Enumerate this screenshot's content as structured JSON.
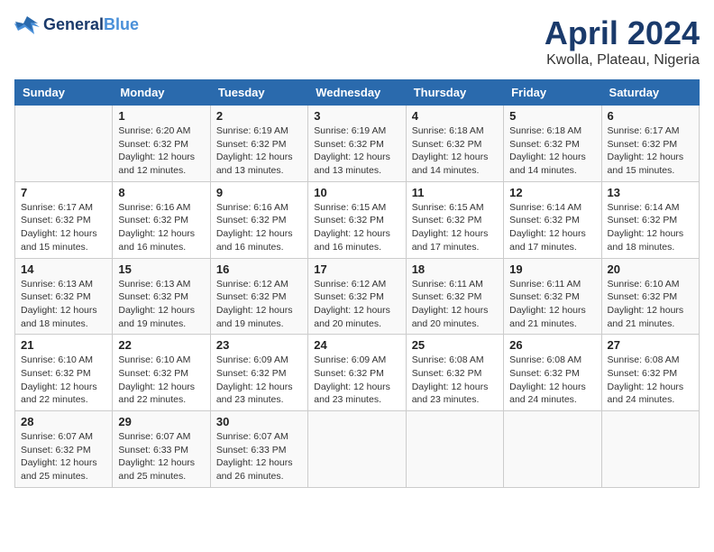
{
  "header": {
    "logo_line1": "General",
    "logo_line2": "Blue",
    "month": "April 2024",
    "location": "Kwolla, Plateau, Nigeria"
  },
  "days_of_week": [
    "Sunday",
    "Monday",
    "Tuesday",
    "Wednesday",
    "Thursday",
    "Friday",
    "Saturday"
  ],
  "weeks": [
    [
      {
        "day": "",
        "info": ""
      },
      {
        "day": "1",
        "info": "Sunrise: 6:20 AM\nSunset: 6:32 PM\nDaylight: 12 hours\nand 12 minutes."
      },
      {
        "day": "2",
        "info": "Sunrise: 6:19 AM\nSunset: 6:32 PM\nDaylight: 12 hours\nand 13 minutes."
      },
      {
        "day": "3",
        "info": "Sunrise: 6:19 AM\nSunset: 6:32 PM\nDaylight: 12 hours\nand 13 minutes."
      },
      {
        "day": "4",
        "info": "Sunrise: 6:18 AM\nSunset: 6:32 PM\nDaylight: 12 hours\nand 14 minutes."
      },
      {
        "day": "5",
        "info": "Sunrise: 6:18 AM\nSunset: 6:32 PM\nDaylight: 12 hours\nand 14 minutes."
      },
      {
        "day": "6",
        "info": "Sunrise: 6:17 AM\nSunset: 6:32 PM\nDaylight: 12 hours\nand 15 minutes."
      }
    ],
    [
      {
        "day": "7",
        "info": "Sunrise: 6:17 AM\nSunset: 6:32 PM\nDaylight: 12 hours\nand 15 minutes."
      },
      {
        "day": "8",
        "info": "Sunrise: 6:16 AM\nSunset: 6:32 PM\nDaylight: 12 hours\nand 16 minutes."
      },
      {
        "day": "9",
        "info": "Sunrise: 6:16 AM\nSunset: 6:32 PM\nDaylight: 12 hours\nand 16 minutes."
      },
      {
        "day": "10",
        "info": "Sunrise: 6:15 AM\nSunset: 6:32 PM\nDaylight: 12 hours\nand 16 minutes."
      },
      {
        "day": "11",
        "info": "Sunrise: 6:15 AM\nSunset: 6:32 PM\nDaylight: 12 hours\nand 17 minutes."
      },
      {
        "day": "12",
        "info": "Sunrise: 6:14 AM\nSunset: 6:32 PM\nDaylight: 12 hours\nand 17 minutes."
      },
      {
        "day": "13",
        "info": "Sunrise: 6:14 AM\nSunset: 6:32 PM\nDaylight: 12 hours\nand 18 minutes."
      }
    ],
    [
      {
        "day": "14",
        "info": "Sunrise: 6:13 AM\nSunset: 6:32 PM\nDaylight: 12 hours\nand 18 minutes."
      },
      {
        "day": "15",
        "info": "Sunrise: 6:13 AM\nSunset: 6:32 PM\nDaylight: 12 hours\nand 19 minutes."
      },
      {
        "day": "16",
        "info": "Sunrise: 6:12 AM\nSunset: 6:32 PM\nDaylight: 12 hours\nand 19 minutes."
      },
      {
        "day": "17",
        "info": "Sunrise: 6:12 AM\nSunset: 6:32 PM\nDaylight: 12 hours\nand 20 minutes."
      },
      {
        "day": "18",
        "info": "Sunrise: 6:11 AM\nSunset: 6:32 PM\nDaylight: 12 hours\nand 20 minutes."
      },
      {
        "day": "19",
        "info": "Sunrise: 6:11 AM\nSunset: 6:32 PM\nDaylight: 12 hours\nand 21 minutes."
      },
      {
        "day": "20",
        "info": "Sunrise: 6:10 AM\nSunset: 6:32 PM\nDaylight: 12 hours\nand 21 minutes."
      }
    ],
    [
      {
        "day": "21",
        "info": "Sunrise: 6:10 AM\nSunset: 6:32 PM\nDaylight: 12 hours\nand 22 minutes."
      },
      {
        "day": "22",
        "info": "Sunrise: 6:10 AM\nSunset: 6:32 PM\nDaylight: 12 hours\nand 22 minutes."
      },
      {
        "day": "23",
        "info": "Sunrise: 6:09 AM\nSunset: 6:32 PM\nDaylight: 12 hours\nand 23 minutes."
      },
      {
        "day": "24",
        "info": "Sunrise: 6:09 AM\nSunset: 6:32 PM\nDaylight: 12 hours\nand 23 minutes."
      },
      {
        "day": "25",
        "info": "Sunrise: 6:08 AM\nSunset: 6:32 PM\nDaylight: 12 hours\nand 23 minutes."
      },
      {
        "day": "26",
        "info": "Sunrise: 6:08 AM\nSunset: 6:32 PM\nDaylight: 12 hours\nand 24 minutes."
      },
      {
        "day": "27",
        "info": "Sunrise: 6:08 AM\nSunset: 6:32 PM\nDaylight: 12 hours\nand 24 minutes."
      }
    ],
    [
      {
        "day": "28",
        "info": "Sunrise: 6:07 AM\nSunset: 6:32 PM\nDaylight: 12 hours\nand 25 minutes."
      },
      {
        "day": "29",
        "info": "Sunrise: 6:07 AM\nSunset: 6:33 PM\nDaylight: 12 hours\nand 25 minutes."
      },
      {
        "day": "30",
        "info": "Sunrise: 6:07 AM\nSunset: 6:33 PM\nDaylight: 12 hours\nand 26 minutes."
      },
      {
        "day": "",
        "info": ""
      },
      {
        "day": "",
        "info": ""
      },
      {
        "day": "",
        "info": ""
      },
      {
        "day": "",
        "info": ""
      }
    ]
  ]
}
